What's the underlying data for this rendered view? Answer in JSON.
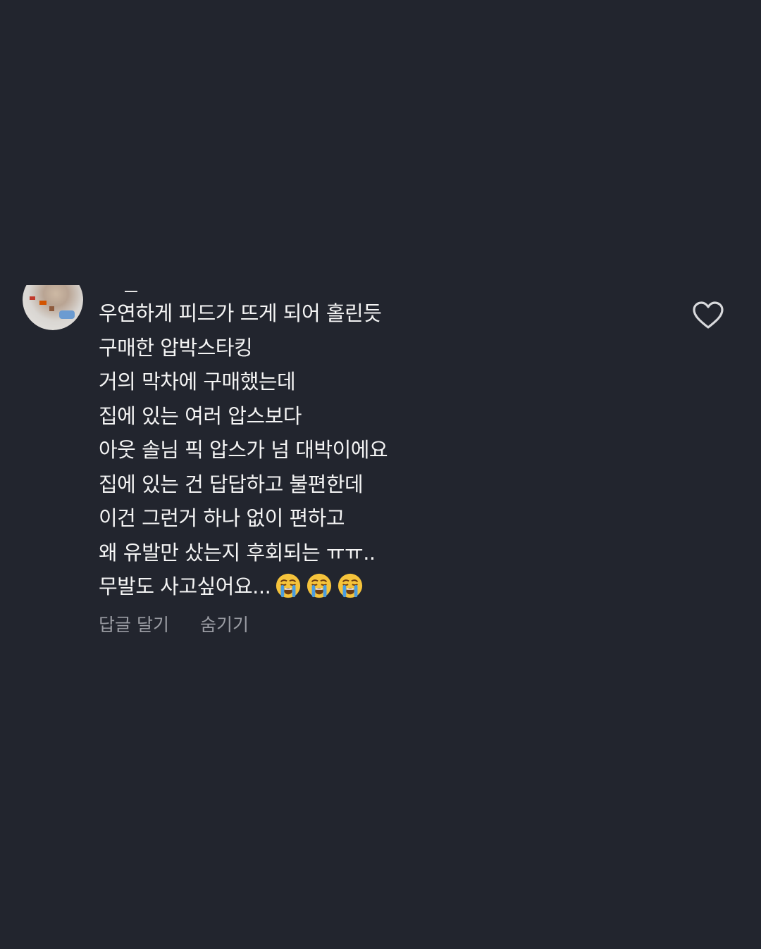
{
  "comment": {
    "lines": [
      "우연하게 피드가 뜨게 되어 홀린듯",
      "구매한 압박스타킹",
      "거의 막차에 구매했는데",
      "집에 있는 여러 압스보다",
      "아웃 솔님 픽 압스가 넘 대박이에요",
      "집에 있는 건 답답하고 불편한데",
      "이건 그런거 하나 없이 편하고",
      "왜 유발만 샀는지 후회되는 ㅠㅠ..",
      "무발도 사고싶어요..."
    ],
    "trailing_emojis": [
      "loudly-crying-face",
      "loudly-crying-face",
      "loudly-crying-face"
    ],
    "actions": {
      "reply": "답글 달기",
      "hide": "숨기기"
    },
    "like_icon": "heart-outline-icon"
  },
  "colors": {
    "background": "#22252e",
    "text": "#f4f4f4",
    "secondary_text": "#9a9ca3",
    "emoji_face": "#f5c33b",
    "emoji_tear": "#4a9de0"
  }
}
